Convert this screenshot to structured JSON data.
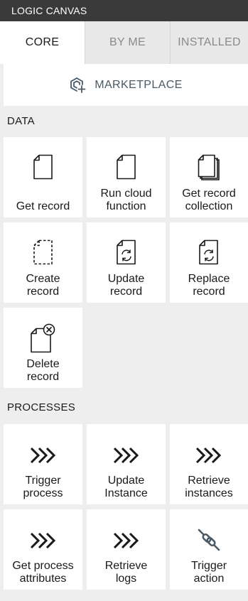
{
  "header": {
    "title": "LOGIC CANVAS"
  },
  "tabs": [
    {
      "label": "CORE",
      "active": true
    },
    {
      "label": "BY ME",
      "active": false
    },
    {
      "label": "INSTALLED",
      "active": false
    }
  ],
  "marketplace": {
    "label": "MARKETPLACE",
    "icon": "marketplace-icon"
  },
  "sections": {
    "data": {
      "title": "DATA",
      "items": [
        {
          "label": "Get record",
          "icon": "document-icon"
        },
        {
          "label": "Run cloud\nfunction",
          "icon": "document-icon"
        },
        {
          "label": "Get record\ncollection",
          "icon": "document-stack-icon"
        },
        {
          "label": "Create\nrecord",
          "icon": "dashed-document-icon"
        },
        {
          "label": "Update\nrecord",
          "icon": "document-refresh-icon"
        },
        {
          "label": "Replace\nrecord",
          "icon": "document-refresh-icon"
        },
        {
          "label": "Delete\nrecord",
          "icon": "document-delete-icon"
        }
      ]
    },
    "processes": {
      "title": "PROCESSES",
      "items": [
        {
          "label": "Trigger\nprocess",
          "icon": "chevrons-icon"
        },
        {
          "label": "Update\nInstance",
          "icon": "chevrons-icon"
        },
        {
          "label": "Retrieve\ninstances",
          "icon": "chevrons-icon"
        },
        {
          "label": "Get process\nattributes",
          "icon": "chevrons-icon"
        },
        {
          "label": "Retrieve\nlogs",
          "icon": "chevrons-icon"
        },
        {
          "label": "Trigger\naction",
          "icon": "link-icon"
        }
      ]
    }
  },
  "colors": {
    "titlebar_bg": "#3a3a3a",
    "panel_bg": "#eeeeee",
    "card_bg": "#ffffff",
    "inactive_tab_text": "#8a8a8a",
    "marketplace_text": "#4a5a66",
    "link_icon": "#4a5a66"
  }
}
